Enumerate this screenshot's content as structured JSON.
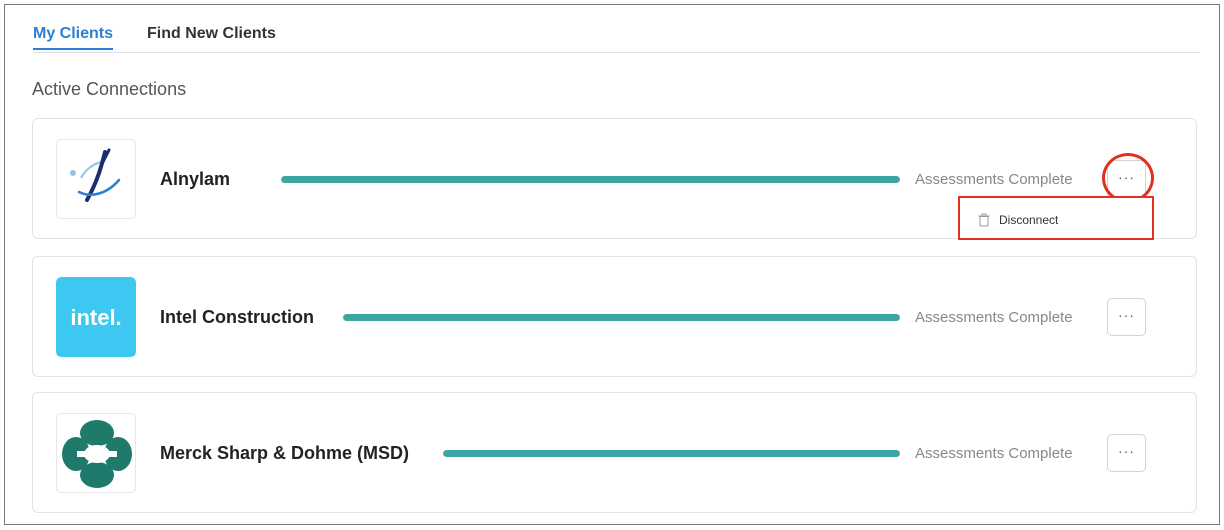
{
  "tabs": [
    {
      "label": "My Clients",
      "active": true
    },
    {
      "label": "Find New Clients",
      "active": false
    }
  ],
  "section_title": "Active Connections",
  "clients": [
    {
      "name": "Alnylam",
      "status": "Assessments Complete",
      "progress": 1.0,
      "logo_icon": "alnylam-logo",
      "logo_bg": "#ffffff"
    },
    {
      "name": "Intel Construction",
      "status": "Assessments Complete",
      "progress": 1.0,
      "logo_icon": "intel-logo",
      "logo_bg": "#3cc8f0",
      "logo_text": "intel."
    },
    {
      "name": "Merck Sharp & Dohme (MSD)",
      "status": "Assessments Complete",
      "progress": 1.0,
      "logo_icon": "msd-logo",
      "logo_bg": "#ffffff"
    }
  ],
  "more_button": {
    "label": "···",
    "icon": "ellipsis-icon"
  },
  "menu": {
    "items": [
      {
        "label": "Disconnect",
        "icon": "trash-icon"
      }
    ]
  },
  "colors": {
    "accent": "#2a7fd4",
    "progress": "#3ba6a0",
    "annotation": "#e03120",
    "msd_green": "#1f7a6c"
  }
}
